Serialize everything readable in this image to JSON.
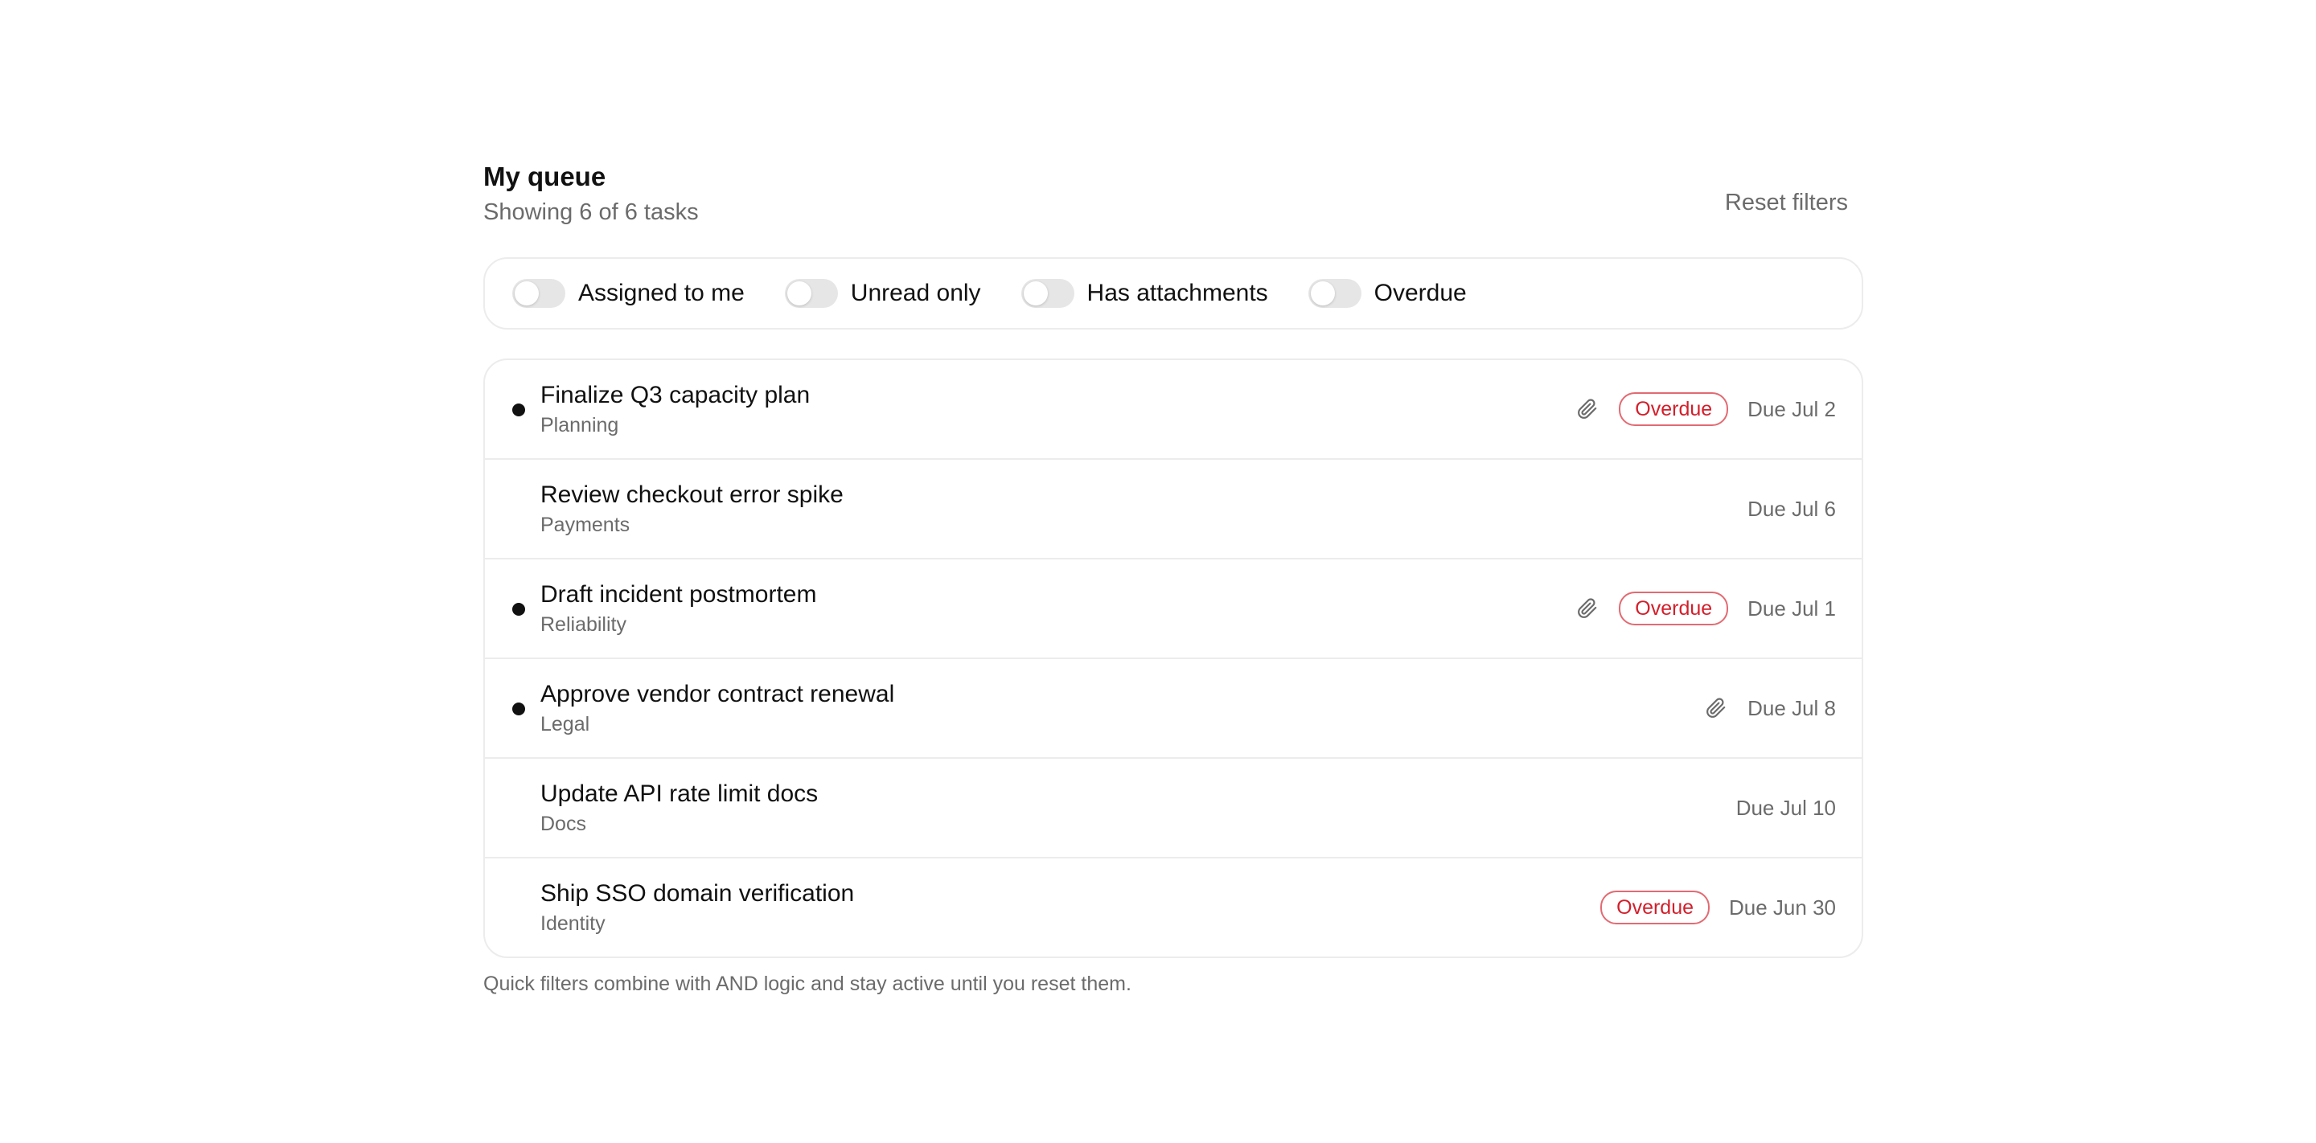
{
  "header": {
    "title": "My queue",
    "subtitle": "Showing 6 of 6 tasks",
    "reset_label": "Reset filters"
  },
  "filters": [
    {
      "label": "Assigned to me",
      "on": false
    },
    {
      "label": "Unread only",
      "on": false
    },
    {
      "label": "Has attachments",
      "on": false
    },
    {
      "label": "Overdue",
      "on": false
    }
  ],
  "tasks": [
    {
      "title": "Finalize Q3 capacity plan",
      "category": "Planning",
      "unread": true,
      "attachment": true,
      "status": "Overdue",
      "due": "Due Jul 2"
    },
    {
      "title": "Review checkout error spike",
      "category": "Payments",
      "unread": false,
      "attachment": false,
      "status": "",
      "due": "Due Jul 6"
    },
    {
      "title": "Draft incident postmortem",
      "category": "Reliability",
      "unread": true,
      "attachment": true,
      "status": "Overdue",
      "due": "Due Jul 1"
    },
    {
      "title": "Approve vendor contract renewal",
      "category": "Legal",
      "unread": true,
      "attachment": true,
      "status": "",
      "due": "Due Jul 8"
    },
    {
      "title": "Update API rate limit docs",
      "category": "Docs",
      "unread": false,
      "attachment": false,
      "status": "",
      "due": "Due Jul 10"
    },
    {
      "title": "Ship SSO domain verification",
      "category": "Identity",
      "unread": false,
      "attachment": false,
      "status": "Overdue",
      "due": "Due Jun 30"
    }
  ],
  "footnote": "Quick filters combine with AND logic and stay active until you reset them.",
  "icons": {
    "attachment": "paperclip-icon",
    "unread": "unread-dot-icon"
  },
  "colors": {
    "overdue_text": "#d31f2b",
    "overdue_border": "#e36a72",
    "muted": "#6b6b6b",
    "border": "#ececec"
  }
}
